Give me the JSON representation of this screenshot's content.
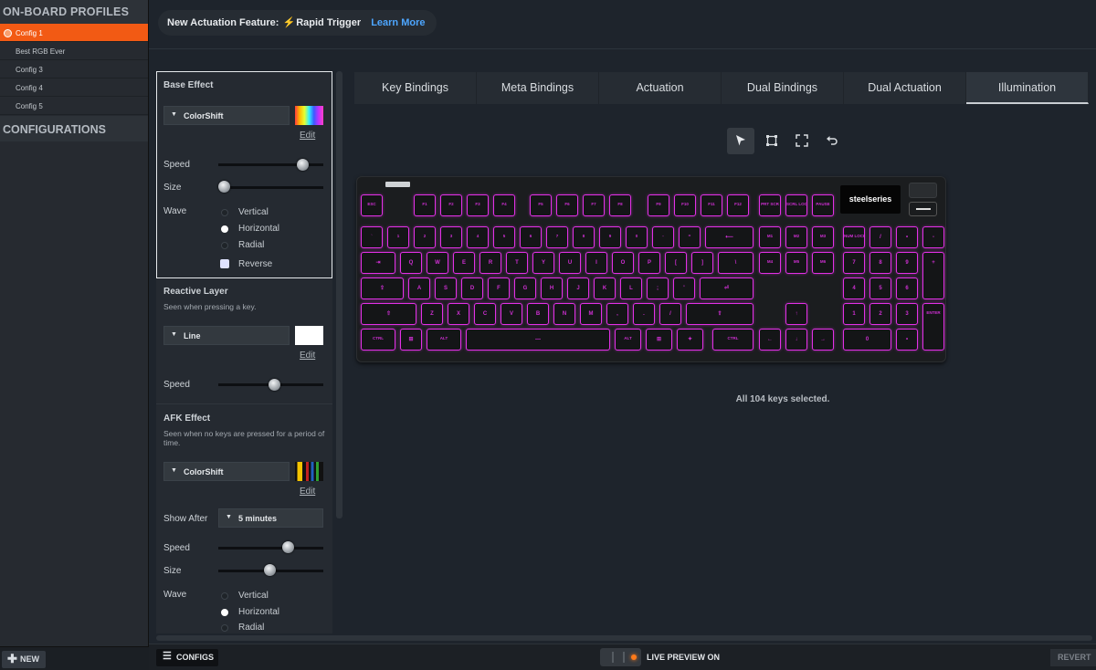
{
  "sidebar": {
    "profiles_heading": "ON-BOARD PROFILES",
    "profiles": [
      "Config 1",
      "Best RGB Ever",
      "Config 3",
      "Config 4",
      "Config 5"
    ],
    "active_profile": "Config 1",
    "configurations_heading": "CONFIGURATIONS",
    "new_label": "NEW"
  },
  "banner": {
    "text": "New Actuation Feature:",
    "feature": "Rapid Trigger",
    "link": "Learn More"
  },
  "tabs": [
    "Key Bindings",
    "Meta Bindings",
    "Actuation",
    "Dual Bindings",
    "Dual Actuation",
    "Illumination"
  ],
  "active_tab": "Illumination",
  "tools": [
    "select-pointer-icon",
    "marquee-select-icon",
    "expand-icon",
    "undo-icon"
  ],
  "base_effect": {
    "title": "Base Effect",
    "effect": "ColorShift",
    "edit": "Edit",
    "speed_label": "Speed",
    "speed_value": 0.8,
    "size_label": "Size",
    "size_value": 0.0,
    "wave_label": "Wave",
    "wave_options": [
      "Vertical",
      "Horizontal",
      "Radial"
    ],
    "wave_selected": "Horizontal",
    "reverse_label": "Reverse"
  },
  "reactive_layer": {
    "title": "Reactive Layer",
    "subtitle": "Seen when pressing a key.",
    "effect": "Line",
    "edit": "Edit",
    "speed_label": "Speed",
    "speed_value": 0.5,
    "color": "#ffffff"
  },
  "afk_effect": {
    "title": "AFK Effect",
    "subtitle": "Seen when no keys are pressed for a period of time.",
    "effect": "ColorShift",
    "edit": "Edit",
    "show_after_label": "Show After",
    "show_after_value": "5 minutes",
    "speed_label": "Speed",
    "speed_value": 0.65,
    "size_label": "Size",
    "size_value": 0.5,
    "wave_label": "Wave",
    "wave_options": [
      "Vertical",
      "Horizontal",
      "Radial"
    ],
    "wave_selected": "Horizontal"
  },
  "keyboard": {
    "brand": "steelseries",
    "key_color": "#e230e6",
    "selection_text": "All 104 keys selected."
  },
  "bottom": {
    "configs_label": "CONFIGS",
    "live_preview_label": "LIVE PREVIEW ON",
    "revert_label": "REVERT"
  }
}
